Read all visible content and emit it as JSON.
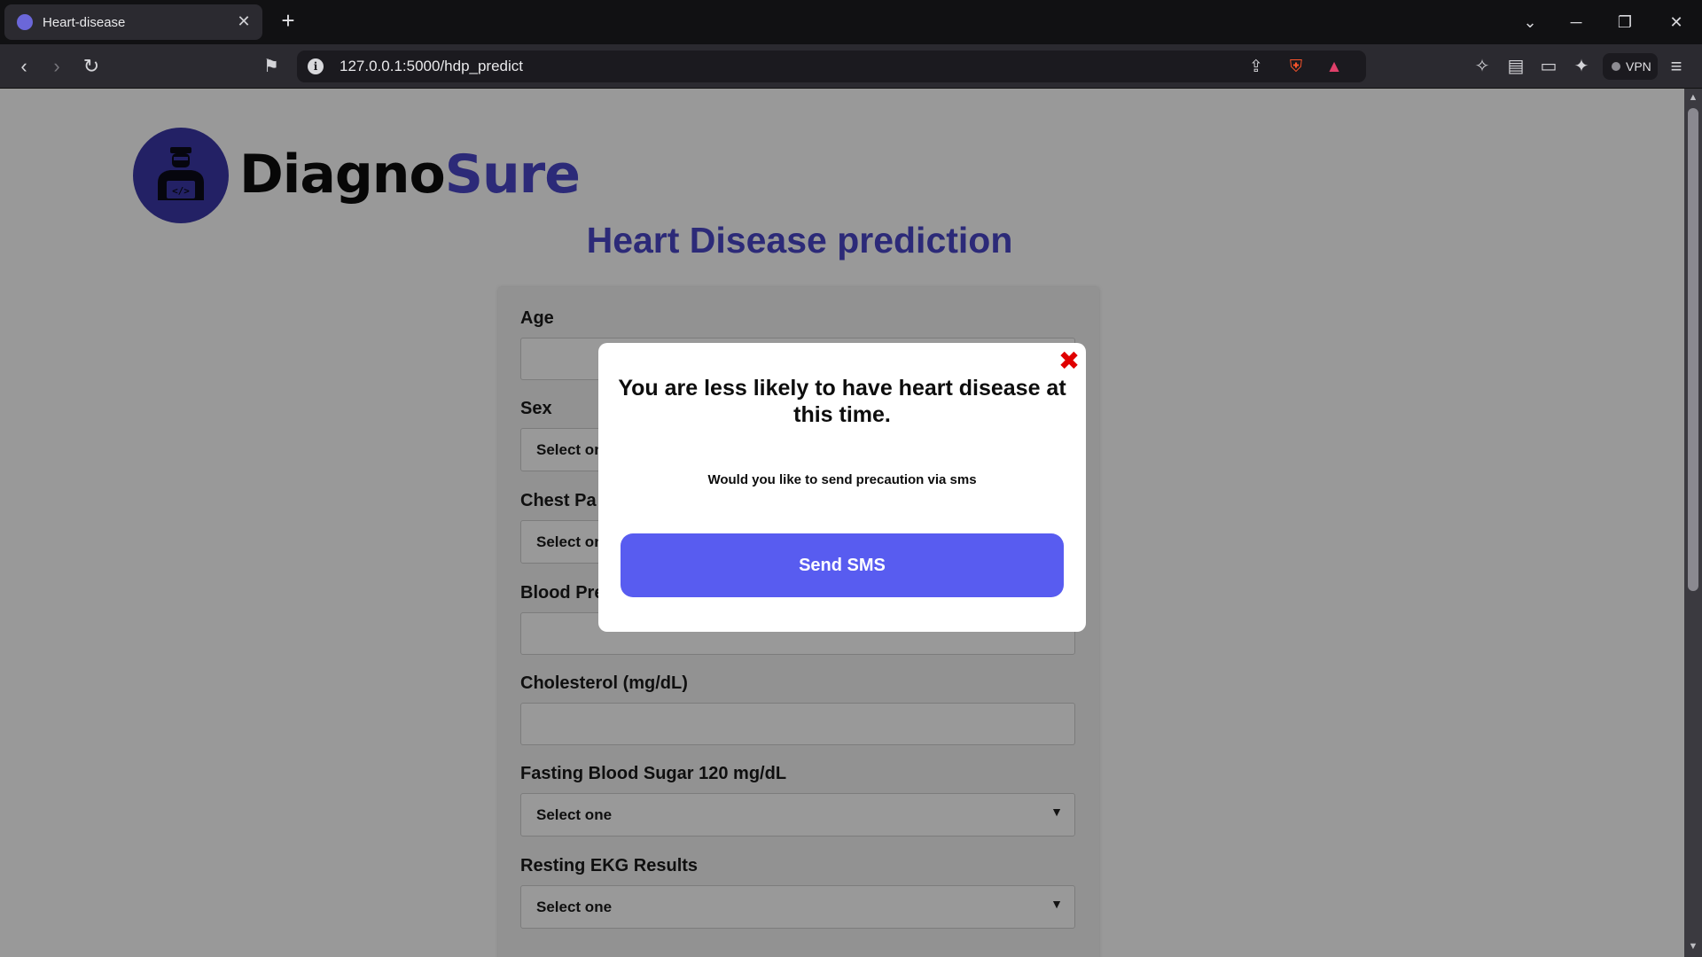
{
  "browser": {
    "tab_title": "Heart-disease",
    "url": "127.0.0.1:5000/hdp_predict",
    "vpn_label": "VPN"
  },
  "brand": {
    "name_part1": "Diagno",
    "name_part2": "Sure"
  },
  "page": {
    "title": "Heart Disease prediction"
  },
  "form": {
    "fields": [
      {
        "label": "Age",
        "type": "input",
        "value": ""
      },
      {
        "label": "Sex",
        "type": "select",
        "value": "Select one"
      },
      {
        "label": "Chest Pa",
        "type": "select",
        "value": "Select one"
      },
      {
        "label": "Blood Pre",
        "type": "input",
        "value": ""
      },
      {
        "label": "Cholesterol (mg/dL)",
        "type": "input",
        "value": ""
      },
      {
        "label": "Fasting Blood Sugar 120 mg/dL",
        "type": "select",
        "value": "Select one"
      },
      {
        "label": "Resting EKG Results",
        "type": "select",
        "value": "Select one"
      }
    ]
  },
  "modal": {
    "heading": "You are less likely to have heart disease at this time.",
    "text": "Would you like to send precaution via sms",
    "button_label": "Send SMS",
    "close_color": "#e00000"
  },
  "colors": {
    "brand_accent": "#4a46c8",
    "button": "#585cf0"
  }
}
